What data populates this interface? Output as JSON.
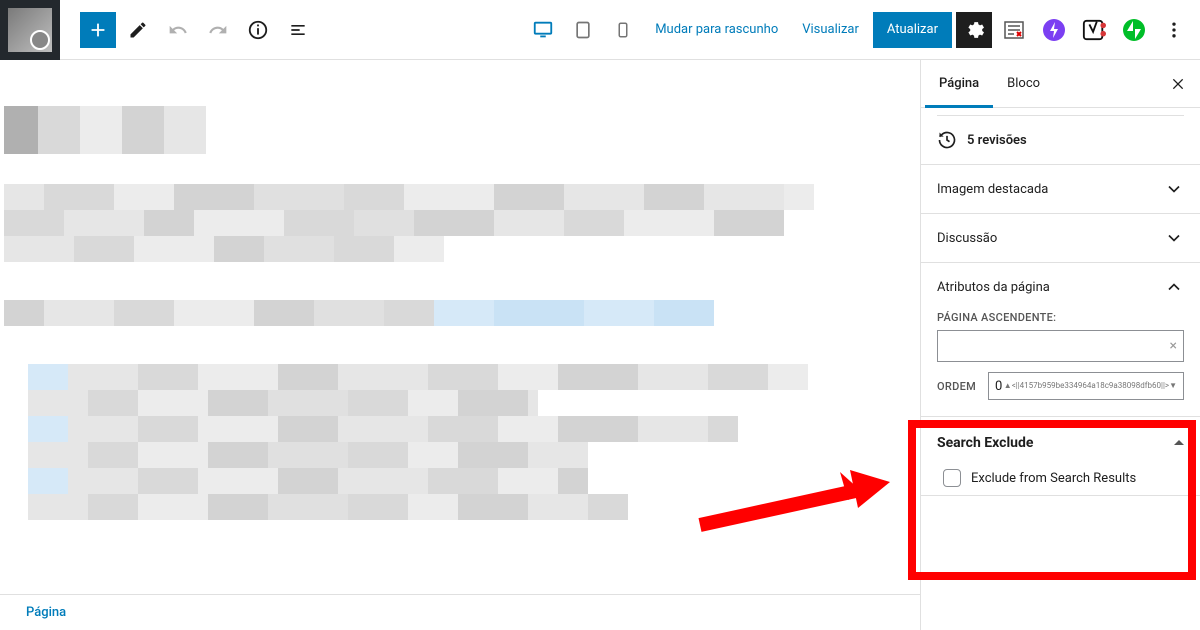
{
  "toolbar": {
    "draft": "Mudar para rascunho",
    "preview": "Visualizar",
    "update": "Atualizar"
  },
  "sidebar": {
    "tabs": {
      "page": "Página",
      "block": "Bloco"
    },
    "revisions": "5 revisões",
    "featured": "Imagem destacada",
    "discussion": "Discussão",
    "attributes": {
      "title": "Atributos da página",
      "parent_label": "PÁGINA ASCENDENTE:",
      "order_label": "ORDEM",
      "order_value": "0"
    },
    "search_exclude": {
      "title": "Search Exclude",
      "checkbox_label": "Exclude from Search Results"
    }
  },
  "breadcrumb": "Página"
}
